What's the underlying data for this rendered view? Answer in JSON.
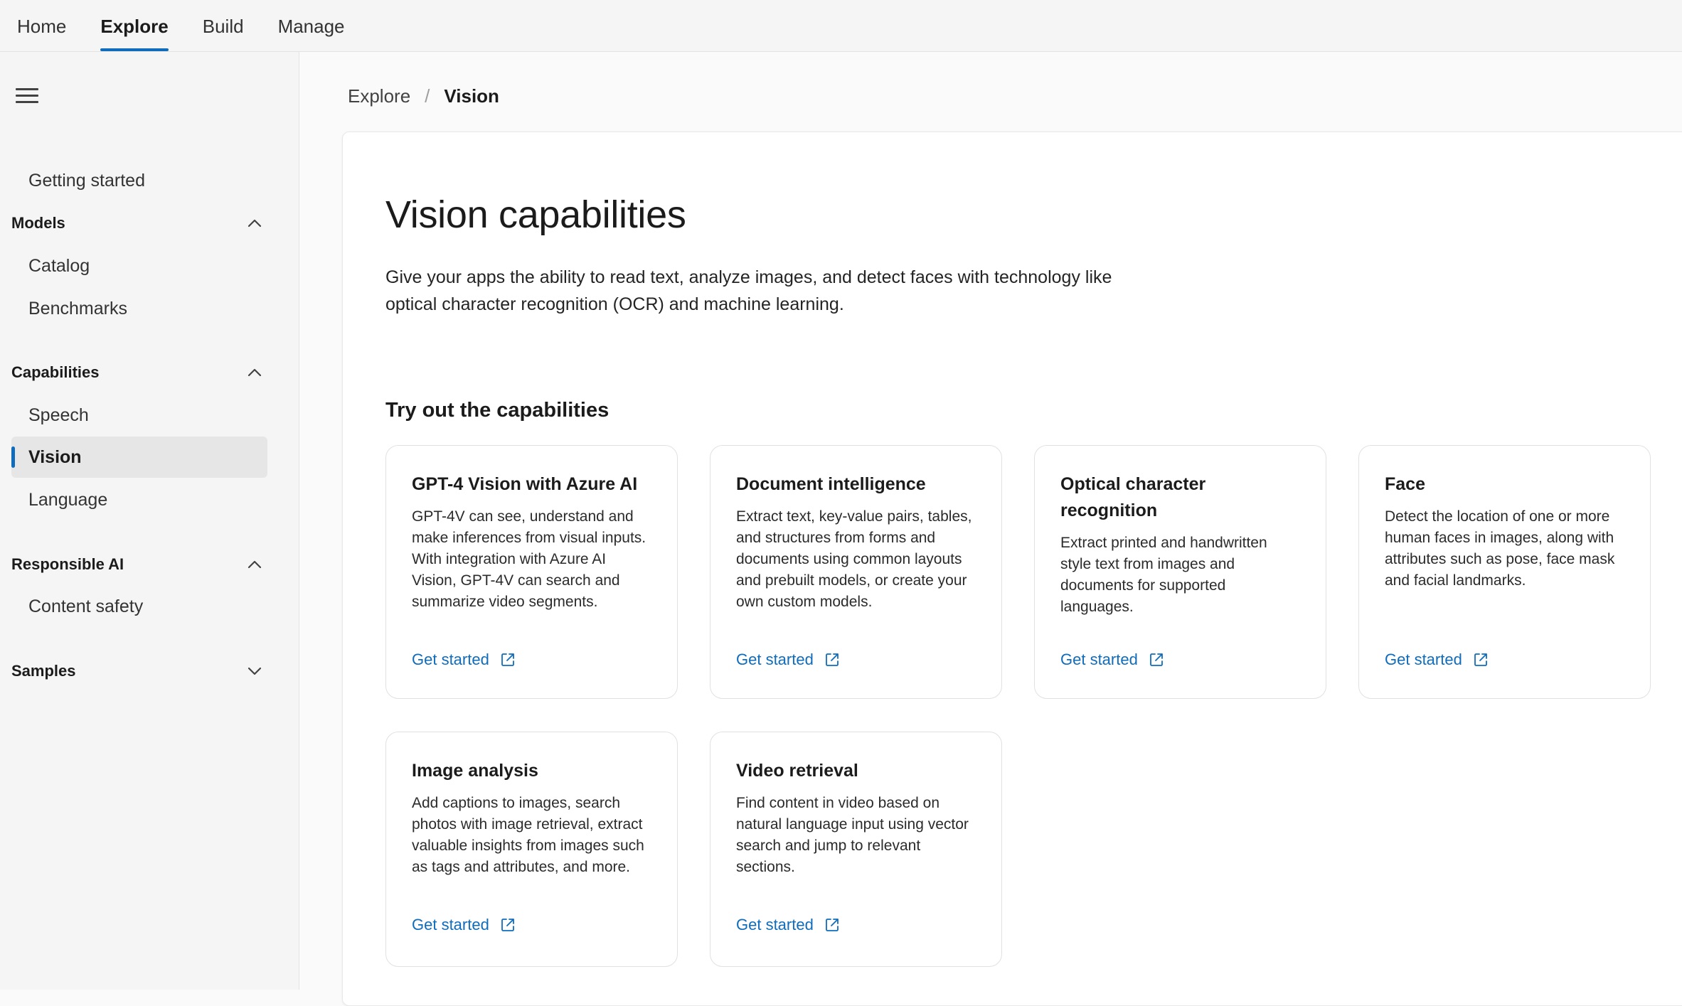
{
  "topnav": {
    "tabs": [
      {
        "label": "Home"
      },
      {
        "label": "Explore",
        "active": true
      },
      {
        "label": "Build"
      },
      {
        "label": "Manage"
      }
    ]
  },
  "sidebar": {
    "getting_started": "Getting started",
    "sections": [
      {
        "label": "Models",
        "expanded": true,
        "items": [
          "Catalog",
          "Benchmarks"
        ]
      },
      {
        "label": "Capabilities",
        "expanded": true,
        "items": [
          "Speech",
          "Vision",
          "Language"
        ],
        "active": "Vision"
      },
      {
        "label": "Responsible AI",
        "expanded": true,
        "items": [
          "Content safety"
        ]
      },
      {
        "label": "Samples",
        "expanded": false,
        "items": []
      }
    ]
  },
  "breadcrumb": {
    "parent": "Explore",
    "separator": "/",
    "current": "Vision"
  },
  "main": {
    "title": "Vision capabilities",
    "description": "Give your apps the ability to read text, analyze images, and detect faces with technology like optical character recognition (OCR) and machine learning.",
    "section_title": "Try out the capabilities",
    "cards": [
      {
        "title": "GPT-4 Vision with Azure AI",
        "description": "GPT-4V can see, understand and make inferences from visual inputs. With integration with Azure AI Vision, GPT-4V can search and summarize video segments.",
        "link": "Get started"
      },
      {
        "title": "Document intelligence",
        "description": "Extract text, key-value pairs, tables, and structures from forms and documents using common layouts and prebuilt models, or create your own custom models.",
        "link": "Get started"
      },
      {
        "title": "Optical character recognition",
        "description": "Extract printed and handwritten style text from images and documents for supported languages.",
        "link": "Get started"
      },
      {
        "title": "Face",
        "description": "Detect the location of one or more human faces in images, along with attributes such as pose, face mask and facial landmarks.",
        "link": "Get started"
      },
      {
        "title": "Image analysis",
        "description": "Add captions to images, search photos with image retrieval, extract valuable insights from images such as tags and attributes, and more.",
        "link": "Get started"
      },
      {
        "title": "Video retrieval",
        "description": "Find content in video based on natural language input using vector search and jump to relevant sections.",
        "link": "Get started"
      }
    ]
  },
  "colors": {
    "accent": "#0f6cbd",
    "sidebar_bg": "#f5f5f5",
    "active_item_bg": "#e6e6e6"
  },
  "icons": {
    "menu": "hamburger-icon",
    "expand": "chevron-up-icon",
    "collapse": "chevron-down-icon",
    "external": "open-in-new-icon"
  }
}
